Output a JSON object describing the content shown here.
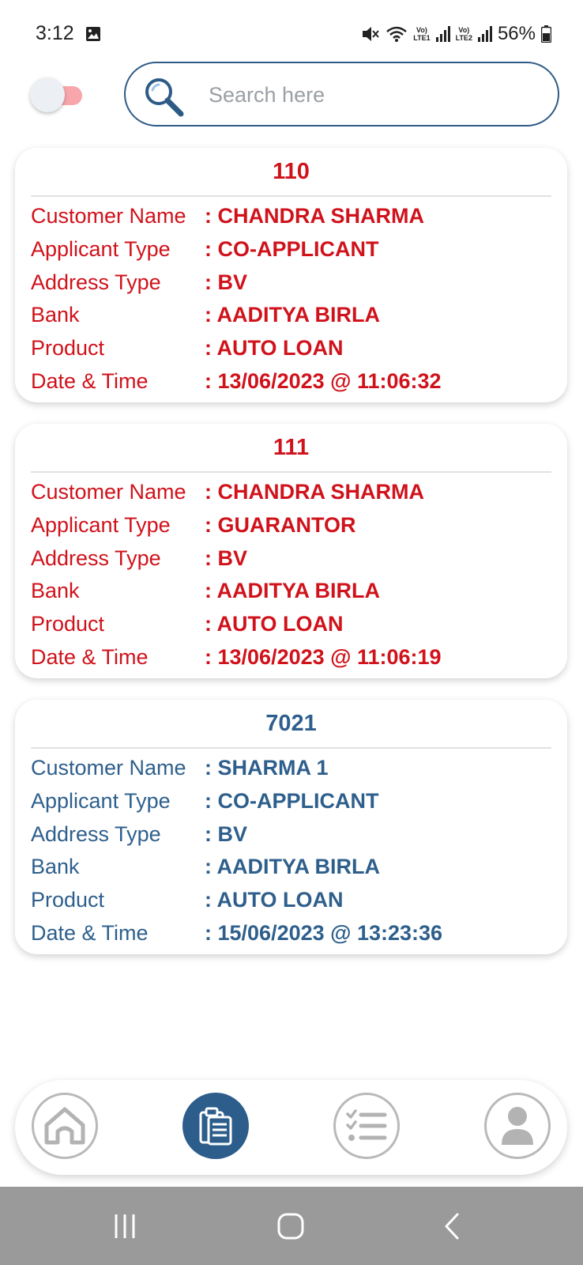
{
  "status_bar": {
    "time": "3:12",
    "battery": "56%",
    "sim1_top": "Vo)",
    "sim1_bottom": "LTE1",
    "sim2_top": "Vo)",
    "sim2_bottom": "LTE2",
    "icons": [
      "gallery-icon",
      "mute-icon",
      "wifi-icon",
      "signal-icon",
      "signal-icon",
      "battery-icon"
    ]
  },
  "header": {
    "toggle_on": true,
    "search_placeholder": "Search here"
  },
  "colors": {
    "red_card_text": "#d0121b",
    "blue_card_text": "#2e5f8c",
    "accent": "#2c5d8b",
    "toggle_track": "#f7a6ab"
  },
  "labels": {
    "customer_name": "Customer Name",
    "applicant_type": "Applicant Type",
    "address_type": "Address Type",
    "bank": "Bank",
    "product": "Product",
    "date_time": "Date & Time"
  },
  "cards": [
    {
      "id": "110",
      "color": "red",
      "customer_name": "CHANDRA SHARMA",
      "applicant_type": "CO-APPLICANT",
      "address_type": "BV",
      "bank": "AADITYA BIRLA",
      "product": "AUTO LOAN",
      "date_time": "13/06/2023 @ 11:06:32"
    },
    {
      "id": "111",
      "color": "red",
      "customer_name": "CHANDRA SHARMA",
      "applicant_type": "GUARANTOR",
      "address_type": "BV",
      "bank": "AADITYA BIRLA",
      "product": "AUTO LOAN",
      "date_time": "13/06/2023 @ 11:06:19"
    },
    {
      "id": "7021",
      "color": "blue",
      "customer_name": "SHARMA 1",
      "applicant_type": "CO-APPLICANT",
      "address_type": "BV",
      "bank": "AADITYA BIRLA",
      "product": "AUTO LOAN",
      "date_time": "15/06/2023 @ 13:23:36"
    }
  ],
  "bottom_nav": {
    "items": [
      "home-icon",
      "clipboard-icon",
      "checklist-icon",
      "user-icon"
    ],
    "active": "clipboard-icon"
  },
  "system_nav": {
    "items": [
      "recents-icon",
      "home-button-icon",
      "back-icon"
    ]
  }
}
